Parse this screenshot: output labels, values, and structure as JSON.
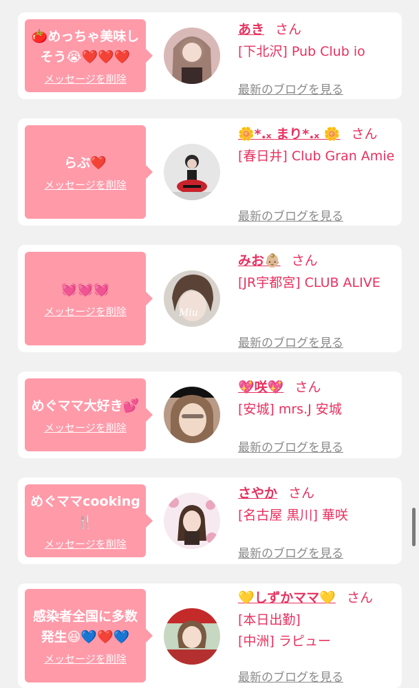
{
  "cards": [
    {
      "message": "🍅めっちゃ美味しそう😭❤️❤️❤️",
      "delete_label": "メッセージを削除",
      "name": "あき",
      "honorific": "さん",
      "shop": "[下北沢] Pub Club io",
      "blog_label": "最新のブログを見る",
      "avatar_icon": "profile-photo-1"
    },
    {
      "message": "らぶ❤️",
      "delete_label": "メッセージを削除",
      "name": "🌼*.ₓ まり*.ₓ 🌼",
      "honorific": "さん",
      "shop": "[春日井] Club Gran Amie",
      "blog_label": "最新のブログを見る",
      "avatar_icon": "profile-photo-2"
    },
    {
      "message": "💓💓💓",
      "delete_label": "メッセージを削除",
      "name": "みお👶🏼",
      "honorific": "さん",
      "shop": "[JR宇都宮] CLUB ALIVE",
      "blog_label": "最新のブログを見る",
      "avatar_icon": "profile-photo-3"
    },
    {
      "message": "めぐママ大好き💕",
      "delete_label": "メッセージを削除",
      "name": "💖咲💖",
      "honorific": "さん",
      "shop": "[安城] mrs.J 安城",
      "blog_label": "最新のブログを見る",
      "avatar_icon": "profile-photo-4"
    },
    {
      "message": "めぐママcooking🍴",
      "delete_label": "メッセージを削除",
      "name": "さやか",
      "honorific": "さん",
      "shop": "[名古屋 黒川] 華咲",
      "blog_label": "最新のブログを見る",
      "avatar_icon": "profile-photo-5"
    },
    {
      "message": "感染者全国に多数発生😆💙❤️💙",
      "delete_label": "メッセージを削除",
      "name": "💛しずかママ💛",
      "honorific": "さん",
      "shop": "[本日出勤]\n[中洲] ラピュー",
      "blog_label": "最新のブログを見る",
      "avatar_icon": "profile-photo-6"
    }
  ],
  "colors": {
    "bubble": "#ff9aa9",
    "accent": "#e8305f",
    "background": "#f1f1f1",
    "link_gray": "#8a8a8a"
  }
}
